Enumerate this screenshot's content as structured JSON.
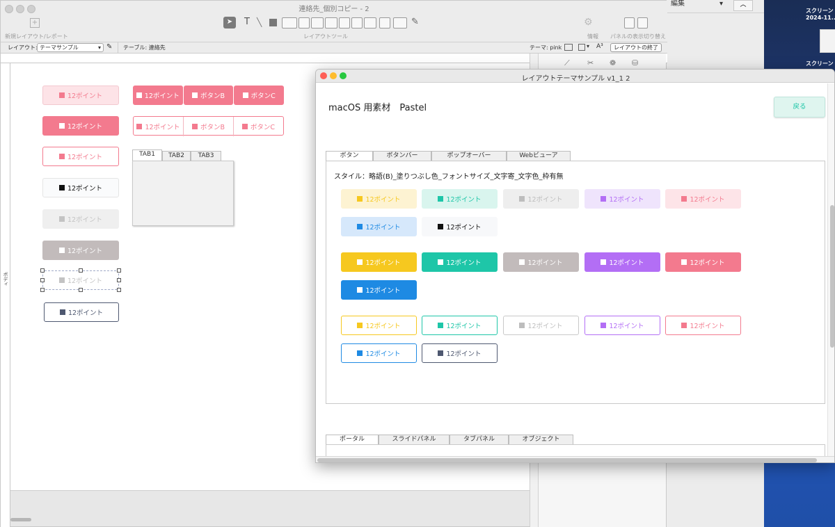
{
  "desktop": {
    "edit_menu": "編集",
    "screenshot_label_1": "スクリーン",
    "screenshot_label_2": "2024-11...",
    "screenshot_label_3": "スクリーン"
  },
  "back_window": {
    "title": "連絡先_個別コピー - 2",
    "toolbar": {
      "new_layout": "新規レイアウト/レポート",
      "layout_tools": "レイアウトツール",
      "inspector": "情報",
      "panel_toggle": "パネルの表示切り替え"
    },
    "layout_label": "レイアウト:",
    "layout_value": "テーマサンプル",
    "table_label": "テーブル: 連絡先",
    "theme_label": "テーマ: pink",
    "exit_layout": "レイアウトの終了",
    "body_label": "ボディ",
    "tab_control": [
      "TAB1",
      "TAB2",
      "TAB3"
    ],
    "buttons": {
      "pt12": "12ポイント",
      "btnB": "ボタンB",
      "btnC": "ボタンC"
    }
  },
  "front_window": {
    "title": "レイアウトテーマサンプル v1_1 2",
    "heading": "macOS 用素材　Pastel",
    "back_button": "戻る",
    "tabs": [
      "ボタン",
      "ボタンバー",
      "ポップオーバー",
      "Webビューア"
    ],
    "style_caption": "スタイル：略語(B)_塗りつぶし色_フォントサイズ_文字寄_文字色_枠有無",
    "button_label": "12ポイント",
    "bottom_tabs": [
      "ポータル",
      "スライドパネル",
      "タブパネル",
      "オブジェクト"
    ]
  },
  "colors": {
    "yellow": "#f6c81f",
    "teal": "#1ec6a8",
    "gray": "#bdbdbd",
    "purple": "#b36ef5",
    "pink": "#f37a8e",
    "blue": "#1e8ae3",
    "navy": "#4e5870",
    "black": "#111111"
  }
}
